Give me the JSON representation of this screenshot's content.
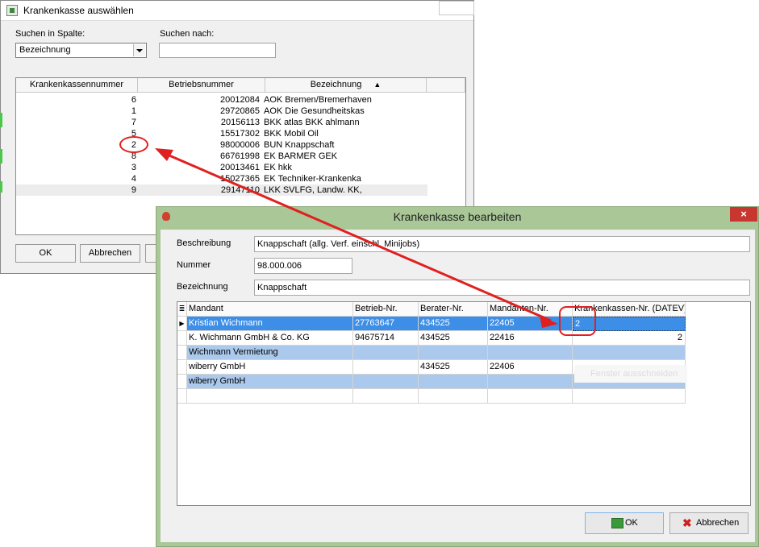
{
  "search_window": {
    "title": "Krankenkasse auswählen",
    "search_column_label": "Suchen in Spalte:",
    "search_column_value": "Bezeichnung",
    "search_for_label": "Suchen nach:",
    "search_for_value": "",
    "columns": [
      "Krankenkassennummer",
      "Betriebsnummer",
      "Bezeichnung"
    ],
    "sort_indicator": "▲",
    "rows": [
      {
        "nr": "6",
        "betrieb": "20012084",
        "bez": "AOK Bremen/Bremerhaven"
      },
      {
        "nr": "1",
        "betrieb": "29720865",
        "bez": "AOK Die Gesundheitskas"
      },
      {
        "nr": "7",
        "betrieb": "20156113",
        "bez": "BKK atlas BKK ahlmann"
      },
      {
        "nr": "5",
        "betrieb": "15517302",
        "bez": "BKK Mobil Oil"
      },
      {
        "nr": "2",
        "betrieb": "98000006",
        "bez": "BUN Knappschaft"
      },
      {
        "nr": "8",
        "betrieb": "66761998",
        "bez": "EK BARMER GEK"
      },
      {
        "nr": "3",
        "betrieb": "20013461",
        "bez": "EK hkk"
      },
      {
        "nr": "4",
        "betrieb": "15027365",
        "bez": "EK Techniker-Krankenka"
      },
      {
        "nr": "9",
        "betrieb": "29147110",
        "bez": "LKK SVLFG, Landw. KK,"
      }
    ],
    "ok_label": "OK",
    "cancel_label": "Abbrechen"
  },
  "edit_window": {
    "title": "Krankenkasse bearbeiten",
    "close_glyph": "×",
    "beschreibung_label": "Beschreibung",
    "beschreibung_value": "Knappschaft (allg. Verf. einschl. Minijobs)",
    "nummer_label": "Nummer",
    "nummer_value": "98.000.006",
    "bezeichnung_label": "Bezeichnung",
    "bezeichnung_value": "Knappschaft",
    "grid_columns": [
      "Mandant",
      "Betrieb-Nr.",
      "Berater-Nr.",
      "Mandanten-Nr.",
      "Krankenkassen-Nr. (DATEV)"
    ],
    "grid_rows": [
      {
        "mandant": "Kristian Wichmann",
        "betrieb": "27763647",
        "berater": "434525",
        "mandanten": "22405",
        "kk": "2"
      },
      {
        "mandant": "K. Wichmann GmbH & Co. KG",
        "betrieb": "94675714",
        "berater": "434525",
        "mandanten": "22416",
        "kk": "2"
      },
      {
        "mandant": "Wichmann Vermietung",
        "betrieb": "",
        "berater": "",
        "mandanten": "",
        "kk": ""
      },
      {
        "mandant": "wiberry GmbH",
        "betrieb": "",
        "berater": "434525",
        "mandanten": "22406",
        "kk": ""
      },
      {
        "mandant": "wiberry GmbH",
        "betrieb": "",
        "berater": "",
        "mandanten": "",
        "kk": ""
      }
    ],
    "ghost_text": "Fenster ausschneiden",
    "ok_label": "OK",
    "cancel_label": "Abbrechen"
  },
  "annotation_color": "#e02020"
}
